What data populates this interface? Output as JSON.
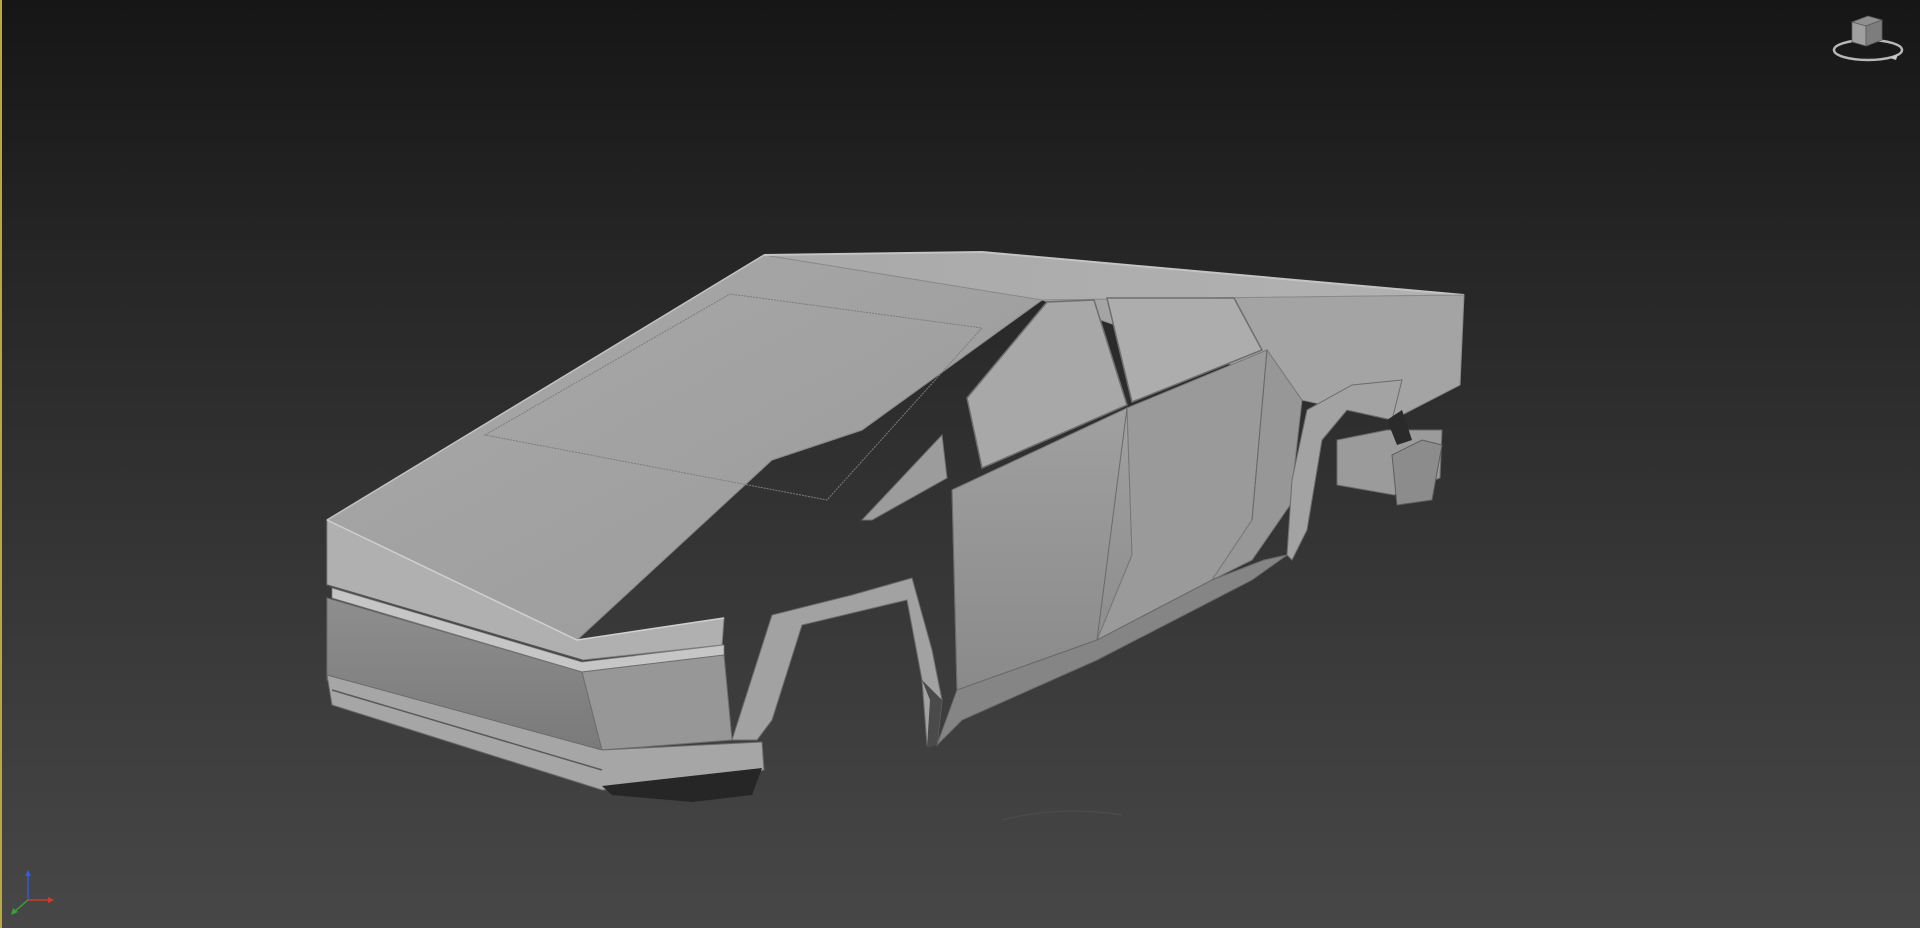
{
  "viewport": {
    "background_top": "#161616",
    "background_bottom": "#474747",
    "active_border_color": "#b8a74a",
    "shading": "default-shading"
  },
  "model": {
    "body_color": "#9e9e9e"
  },
  "viewcube": {
    "icon": "viewcube-icon"
  },
  "axis_tripod": {
    "x_axis_color": "#d03a2a",
    "y_axis_color": "#3aa03a",
    "z_axis_color": "#3a5ad0"
  }
}
